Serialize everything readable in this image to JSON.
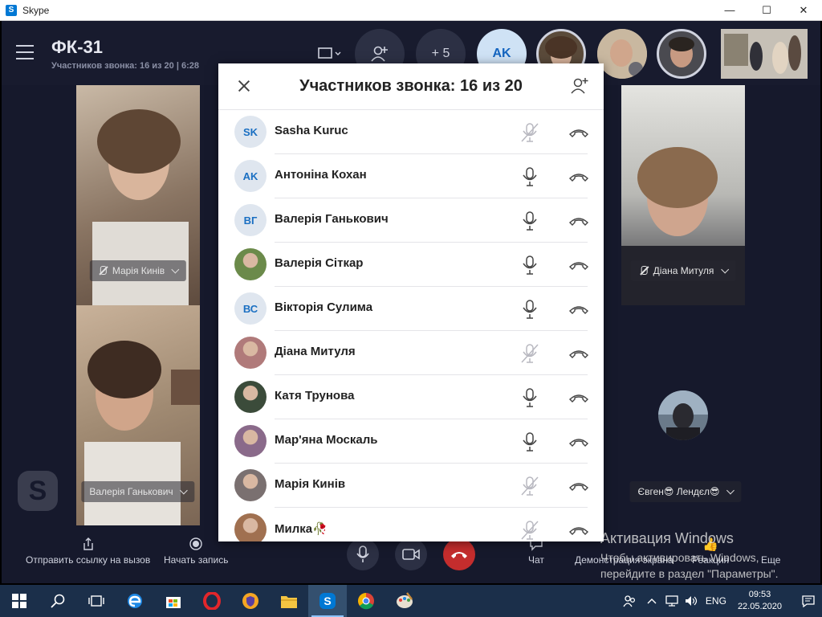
{
  "window": {
    "title": "Skype",
    "icon_letter": "S",
    "minimize": "—",
    "maximize": "☐",
    "close": "✕"
  },
  "call": {
    "title": "ФК-31",
    "subtitle": "Участников звонка: 16 из 20 | 6:28",
    "more_count": "+ 5",
    "avatar_initials": "AK"
  },
  "tiles": [
    {
      "label": "Марія Кинів"
    },
    {
      "label": "Діана Митуля"
    },
    {
      "label": "Валерія Ганькович"
    },
    {
      "label": "Євген😎 Лендєл😎"
    }
  ],
  "bottom": {
    "share_link": "Отправить ссылку на вызов",
    "record": "Начать запись",
    "chat": "Чат",
    "screen_share": "Демонстрация экрана",
    "reaction": "Реакция",
    "more": "Еще"
  },
  "watermark": {
    "line1": "Активация Windows",
    "line2": "Чтобы активировать Windows,",
    "line3": "перейдите в раздел \"Параметры\"."
  },
  "modal": {
    "title": "Участников звонка: 16 из 20",
    "participants": [
      {
        "initials": "SK",
        "name": "Sasha Kuruc",
        "muted": true,
        "photo": ""
      },
      {
        "initials": "AK",
        "name": "Антоніна Кохан",
        "muted": false,
        "photo": ""
      },
      {
        "initials": "ВГ",
        "name": "Валерія Ганькович",
        "muted": false,
        "photo": ""
      },
      {
        "initials": "",
        "name": "Валерія Сіткар",
        "muted": false,
        "photo": "#6b8a4a"
      },
      {
        "initials": "ВС",
        "name": "Вікторія Сулима",
        "muted": false,
        "photo": ""
      },
      {
        "initials": "",
        "name": "Діана Митуля",
        "muted": true,
        "photo": "#b07a7a"
      },
      {
        "initials": "",
        "name": "Катя Трунова",
        "muted": false,
        "photo": "#3b4b3a"
      },
      {
        "initials": "",
        "name": "Мар'яна Москаль",
        "muted": false,
        "photo": "#8a6a8a"
      },
      {
        "initials": "",
        "name": "Марія Кинів",
        "muted": true,
        "photo": "#7a7070"
      },
      {
        "initials": "",
        "name": "Милка🥀",
        "muted": true,
        "photo": "#a07050"
      }
    ]
  },
  "taskbar": {
    "lang": "ENG",
    "time": "09:53",
    "date": "22.05.2020"
  }
}
